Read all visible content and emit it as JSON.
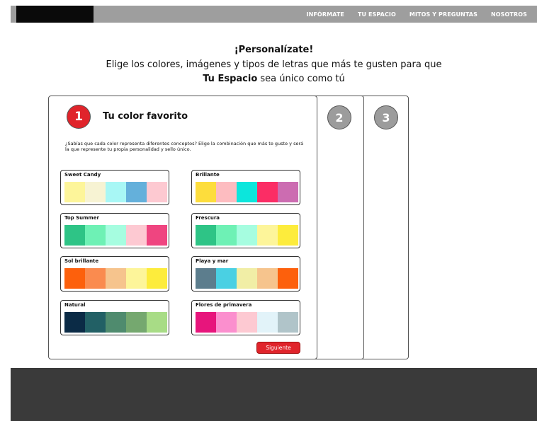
{
  "nav": {
    "links": [
      "INFÓRMATE",
      "TU ESPACIO",
      "MITOS Y PREGUNTAS",
      "NOSOTROS"
    ]
  },
  "hero": {
    "title": "¡Personalízate!",
    "line1": "Elige los colores, imágenes y tipos de letras que más te gusten para que",
    "line2_bold": "Tu Espacio",
    "line2_rest": " sea único como tú"
  },
  "steps": {
    "step1_number": "1",
    "step2_number": "2",
    "step3_number": "3",
    "title": "Tu color favorito",
    "description": "¿Sabías que cada color representa diferentes conceptos? Elige la combinación que más te guste y será la que represente tu propia personalidad y sello único."
  },
  "palettes": [
    {
      "name": "Sweet Candy",
      "colors": [
        "#fdf59a",
        "#f7f3d3",
        "#a8f7f5",
        "#64b0db",
        "#fdc9d1"
      ]
    },
    {
      "name": "Brillante",
      "colors": [
        "#fddd3c",
        "#fdbcc0",
        "#0ce6dc",
        "#fb2d65",
        "#cc6cb1"
      ]
    },
    {
      "name": "Top Summer",
      "colors": [
        "#2ec486",
        "#6ef1b5",
        "#a6fde0",
        "#fdc9d2",
        "#ef4580"
      ]
    },
    {
      "name": "Frescura",
      "colors": [
        "#2ec486",
        "#6ef1b5",
        "#a6fde0",
        "#fdf59a",
        "#fdec3c"
      ]
    },
    {
      "name": "Sol brillante",
      "colors": [
        "#fd600c",
        "#fa8b4f",
        "#f6c48d",
        "#fdf59a",
        "#fdec3c"
      ]
    },
    {
      "name": "Playa y mar",
      "colors": [
        "#5c7d8d",
        "#4ad0e3",
        "#f1eea6",
        "#f6c48d",
        "#fd600c"
      ]
    },
    {
      "name": "Natural",
      "colors": [
        "#0b2b46",
        "#226065",
        "#4f8b6e",
        "#75a86f",
        "#a8dc86"
      ]
    },
    {
      "name": "Flores de primavera",
      "colors": [
        "#e7157c",
        "#fb8fce",
        "#fdc9d2",
        "#e2f3f9",
        "#b0c4c9"
      ]
    }
  ],
  "next_button": "Siguiente",
  "colors": {
    "navbar": "#9e9e9e",
    "logo": "#0a0a0a",
    "accent_red": "#e0242b",
    "step_gray": "#9c9c9c",
    "footer": "#3a3a3a"
  }
}
